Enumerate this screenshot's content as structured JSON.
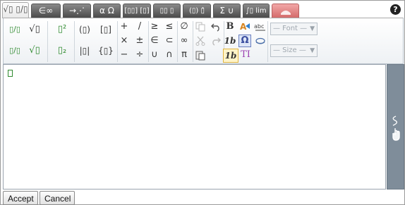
{
  "tabs": [
    {
      "label": "√▯ ▯/▯",
      "active": true
    },
    {
      "label": "∈∞"
    },
    {
      "label": "→⋰"
    },
    {
      "label": "α Ω"
    },
    {
      "label": "[▯▯] [▯]"
    },
    {
      "label": "▯▯ ▯"
    },
    {
      "label": "(▯) ▯̂"
    },
    {
      "label": "Σ ∪"
    },
    {
      "label": "∫▯ lim"
    },
    {
      "label": "hand"
    }
  ],
  "help": "?",
  "toolbar": {
    "fractions": [
      "▯/▯",
      "√▯",
      "▯/▯",
      "√▯"
    ],
    "scripts": [
      "▯²",
      "▯₂"
    ],
    "brackets": [
      "(▯)",
      "[▯]",
      "|▯|",
      "{▯}"
    ],
    "operators": [
      "+",
      "/",
      "×",
      "±",
      "−",
      "÷"
    ],
    "relations": [
      "≥",
      "≤",
      "∈",
      "⊂",
      "∪",
      "∩"
    ],
    "misc": [
      "∅",
      "∞",
      "π"
    ],
    "edit_icons": [
      "copy-icon",
      "undo-icon",
      "cut-icon",
      "redo-icon",
      "paste-icon"
    ],
    "format": {
      "bold": "B",
      "italic1": "1b",
      "italic2": "1b",
      "text": "T",
      "omega": "Ω"
    },
    "font_placeholder": "— Font —",
    "size_placeholder": "— Size —"
  },
  "editor": {
    "content": ""
  },
  "buttons": {
    "accept": "Accept",
    "cancel": "Cancel"
  }
}
